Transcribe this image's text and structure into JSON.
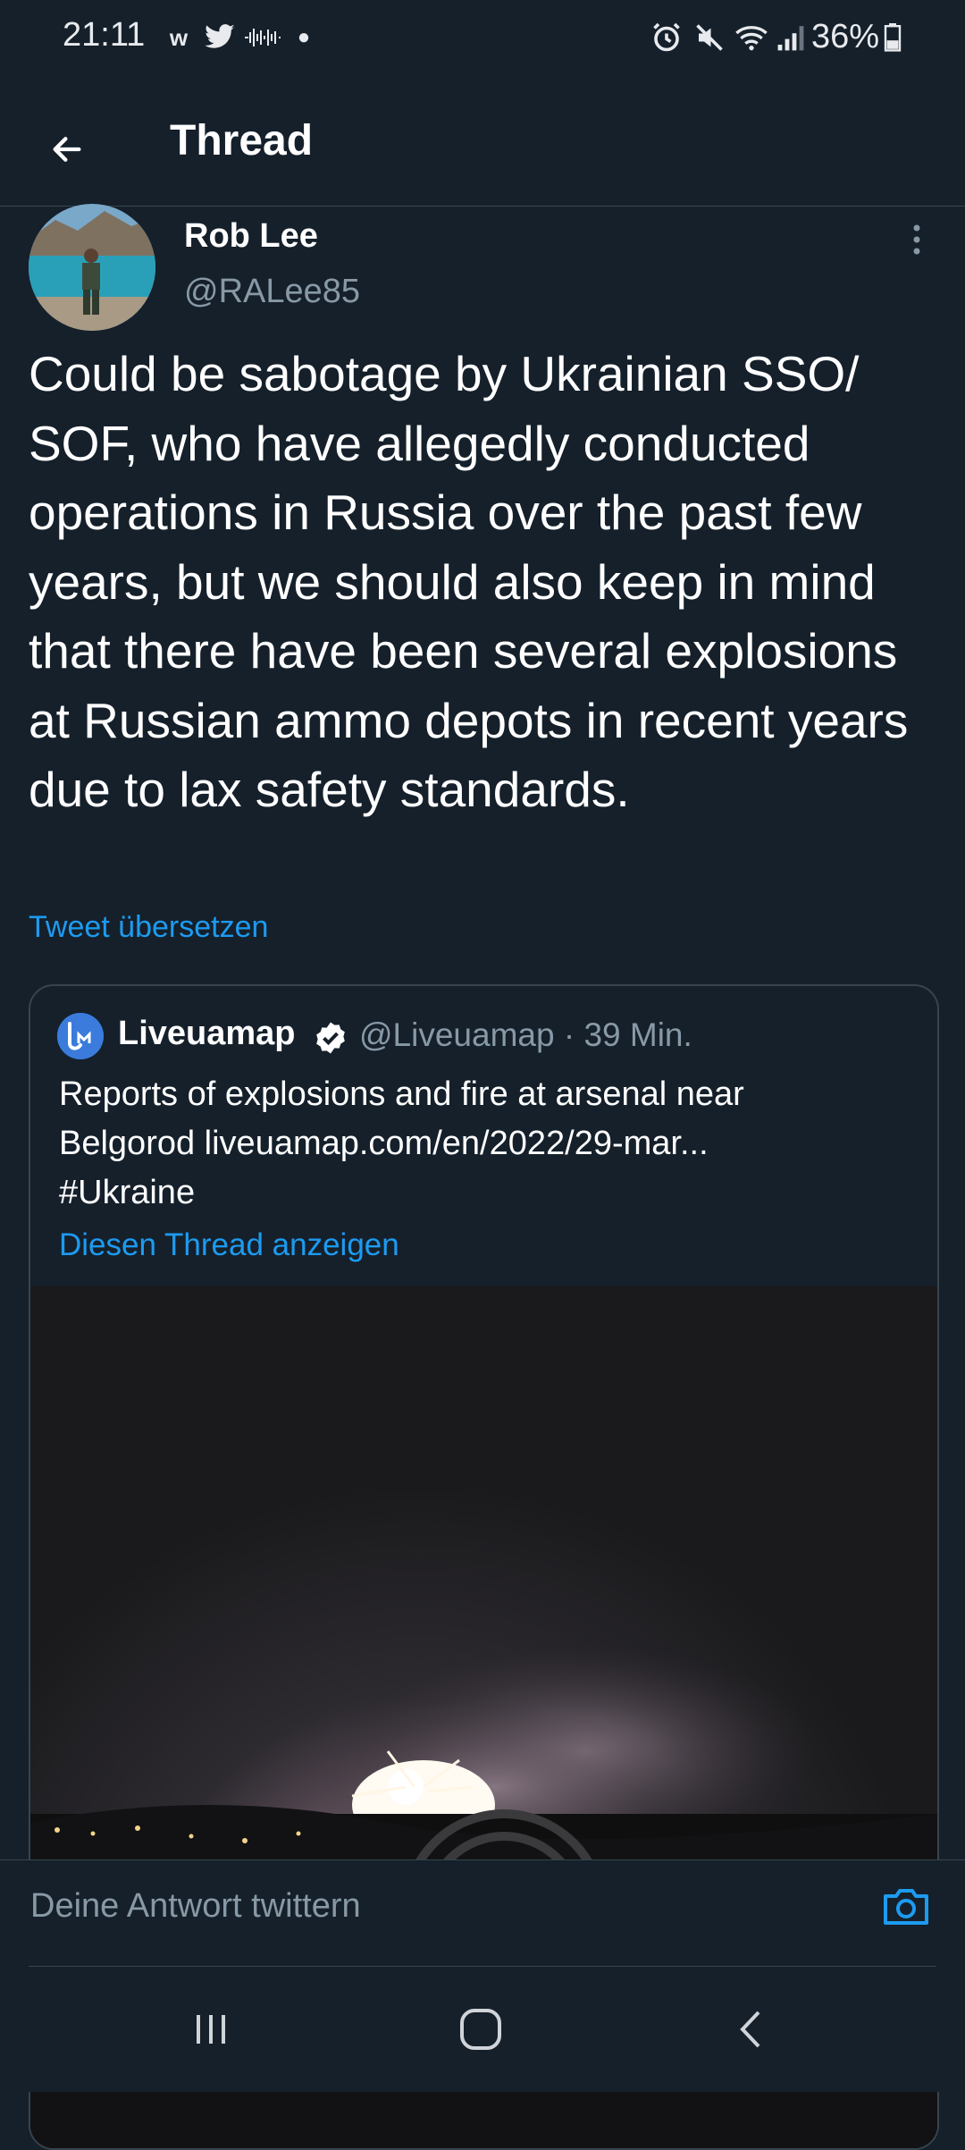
{
  "status_bar": {
    "time": "21:11",
    "battery": "36%",
    "notification_icons": [
      "w-icon",
      "twitter-icon",
      "waveform-icon",
      "dot-icon"
    ],
    "system_icons": [
      "alarm-icon",
      "mute-icon",
      "wifi-icon",
      "signal-icon",
      "battery-icon"
    ]
  },
  "header": {
    "title": "Thread",
    "back_icon": "arrow-left-icon"
  },
  "tweet": {
    "author_name": "Rob Lee",
    "author_handle": "@RALee85",
    "text": "Could be sabotage by Ukrainian SSO/ SOF, who have allegedly conducted operations in Russia over the past few years, but we should also keep in mind that there have been several explosions at Russian ammo depots in recent years due to lax safety standards.",
    "translate_label": "Tweet übersetzen"
  },
  "quote": {
    "author_name": "Liveuamap",
    "author_handle": "@Liveuamap",
    "time": "· 39 Min.",
    "text_line1": "Reports of explosions and fire at arsenal near",
    "text_line2": "Belgorod liveuamap.com/en/2022/29-mar...",
    "text_line3": "#Ukraine",
    "show_thread_label": "Diesen Thread anzeigen",
    "avatar_text": "LM"
  },
  "reply": {
    "placeholder": "Deine Antwort twittern"
  },
  "colors": {
    "background": "#15202b",
    "accent": "#1d9bf0",
    "secondary_text": "#8899a6",
    "border": "#38444d"
  }
}
